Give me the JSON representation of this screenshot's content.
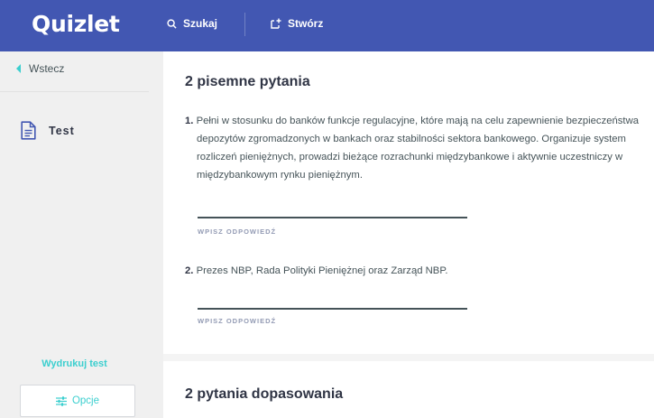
{
  "header": {
    "logo": "Quizlet",
    "search_label": "Szukaj",
    "create_label": "Stwórz"
  },
  "sidebar": {
    "back_label": "Wstecz",
    "mode_label": "Test",
    "print_label": "Wydrukuj test",
    "options_label": "Opcje"
  },
  "main": {
    "written_section_title": "2 pisemne pytania",
    "questions": [
      {
        "number": "1.",
        "text": "Pełni w stosunku do banków funkcje regulacyjne, które mają na celu zapewnienie bezpieczeństwa depozytów zgromadzonych w bankach oraz stabilności sektora bankowego. Organizuje system rozliczeń pieniężnych, prowadzi bieżące rozrachunki międzybankowe i aktywnie uczestniczy w międzybankowym rynku pieniężnym.",
        "answer_label": "WPISZ ODPOWIEDŹ"
      },
      {
        "number": "2.",
        "text": "Prezes NBP, Rada Polityki Pieniężnej oraz Zarząd NBP.",
        "answer_label": "WPISZ ODPOWIEDŹ"
      }
    ],
    "matching_section_title": "2 pytania dopasowania"
  },
  "colors": {
    "brand": "#4257b2",
    "accent": "#3ccfcf",
    "text": "#455358"
  }
}
